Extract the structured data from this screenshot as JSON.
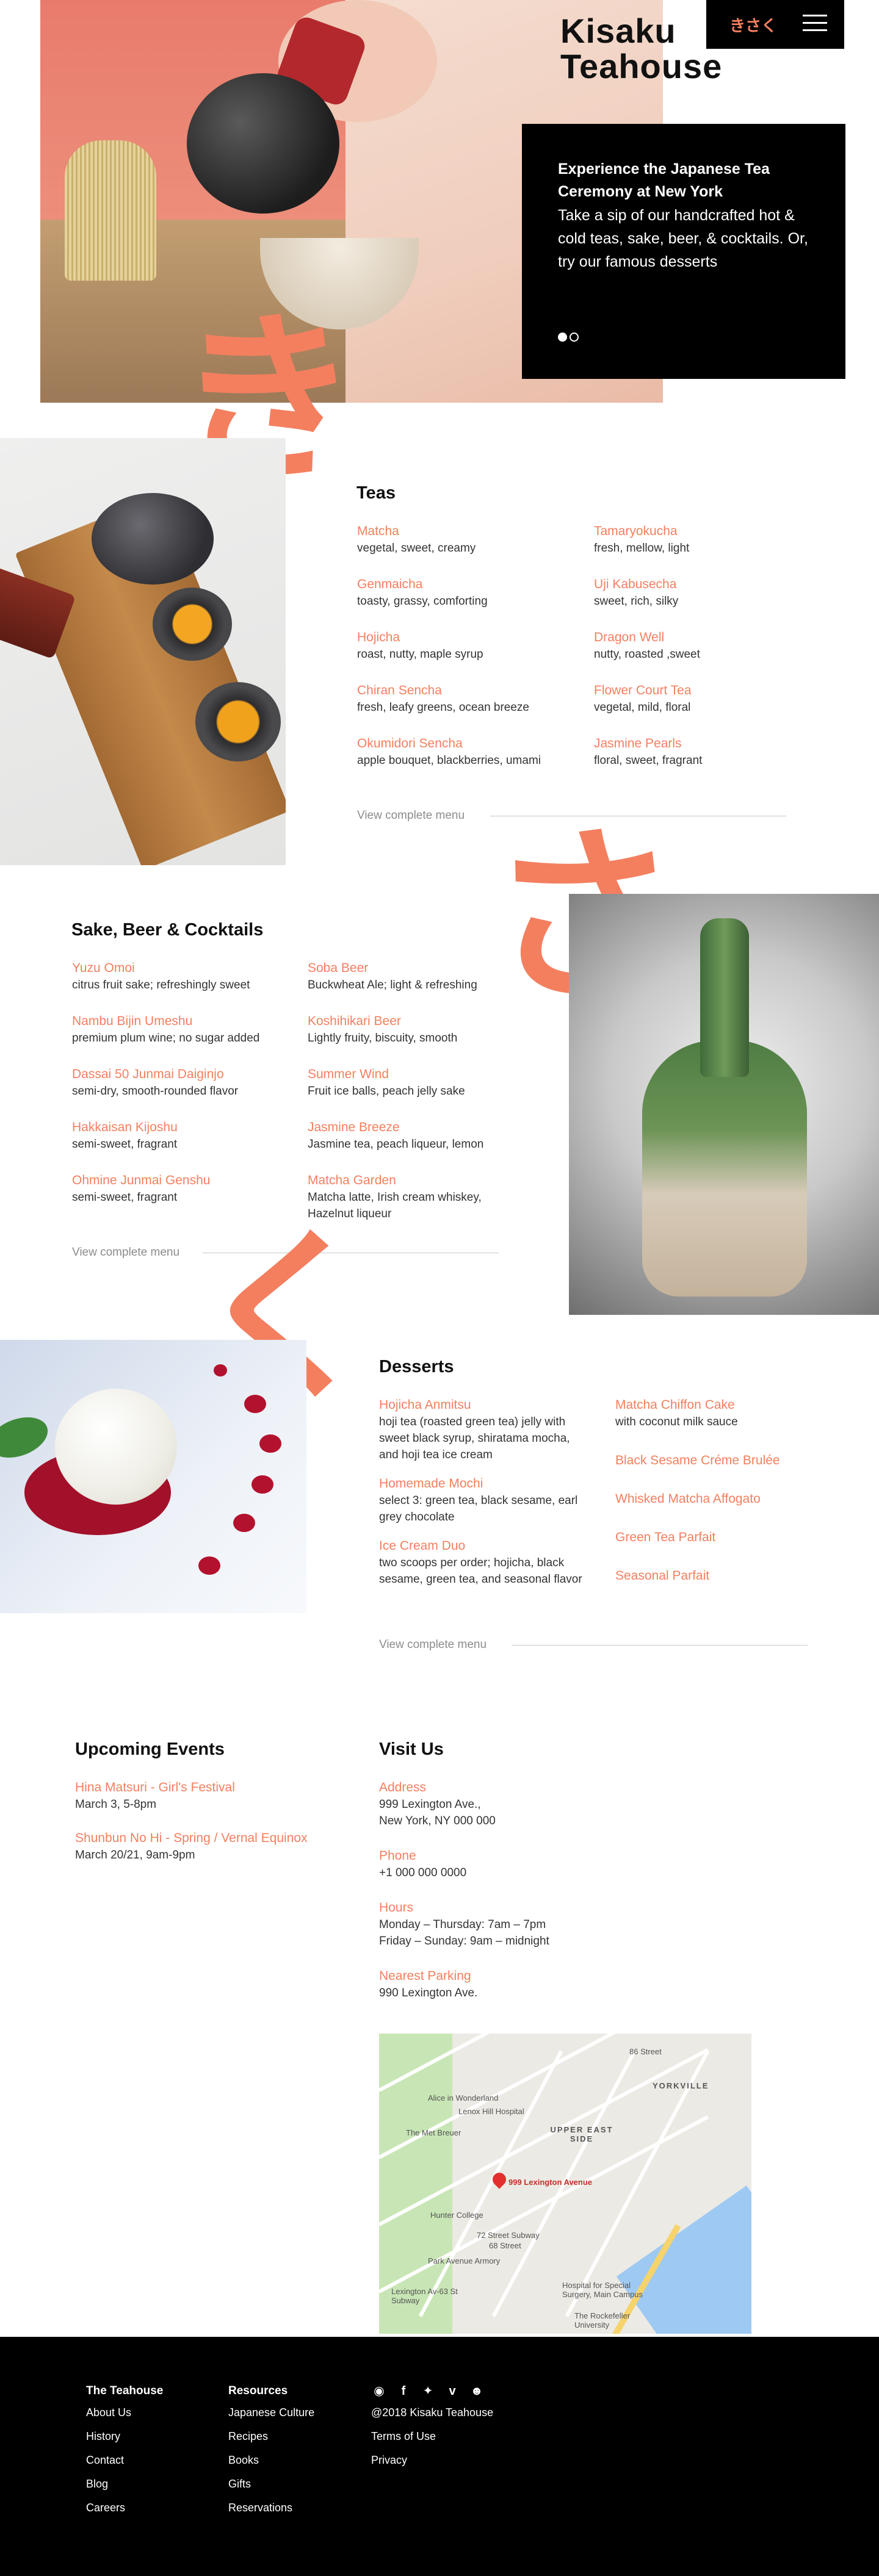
{
  "brand": {
    "name_line1": "Kisaku",
    "name_line2": "Teahouse",
    "logo_kana": "きさく"
  },
  "hero": {
    "heading": "Experience the Japanese Tea Ceremony at New York",
    "body": "Take a sip of our handcrafted hot & cold teas, sake, beer, & cocktails. Or, try our famous desserts"
  },
  "kana": {
    "ki": "き",
    "sa": "さ",
    "ku": "く"
  },
  "teas": {
    "title": "Teas",
    "items": [
      {
        "name": "Matcha",
        "desc": "vegetal, sweet, creamy"
      },
      {
        "name": "Tamaryokucha",
        "desc": "fresh, mellow, light"
      },
      {
        "name": "Genmaicha",
        "desc": "toasty, grassy, comforting"
      },
      {
        "name": "Uji Kabusecha",
        "desc": "sweet, rich, silky"
      },
      {
        "name": "Hojicha",
        "desc": "roast, nutty, maple syrup"
      },
      {
        "name": "Dragon Well",
        "desc": "nutty, roasted ,sweet"
      },
      {
        "name": "Chiran Sencha",
        "desc": "fresh, leafy greens, ocean breeze"
      },
      {
        "name": "Flower Court Tea",
        "desc": "vegetal, mild, floral"
      },
      {
        "name": "Okumidori Sencha",
        "desc": "apple bouquet, blackberries, umami"
      },
      {
        "name": "Jasmine Pearls",
        "desc": "floral, sweet, fragrant"
      }
    ],
    "link": "View complete menu"
  },
  "sake": {
    "title": "Sake, Beer & Cocktails",
    "items": [
      {
        "name": "Yuzu Omoi",
        "desc": "citrus fruit sake; refreshingly sweet"
      },
      {
        "name": "Soba Beer",
        "desc": "Buckwheat Ale; light & refreshing"
      },
      {
        "name": "Nambu Bijin Umeshu",
        "desc": "premium plum wine; no sugar added"
      },
      {
        "name": "Koshihikari Beer",
        "desc": "Lightly fruity, biscuity, smooth"
      },
      {
        "name": "Dassai 50 Junmai Daiginjo",
        "desc": "semi-dry, smooth-rounded flavor"
      },
      {
        "name": "Summer Wind",
        "desc": "Fruit ice balls, peach jelly sake"
      },
      {
        "name": "Hakkaisan Kijoshu",
        "desc": "semi-sweet, fragrant"
      },
      {
        "name": "Jasmine Breeze",
        "desc": "Jasmine tea, peach liqueur, lemon"
      },
      {
        "name": "Ohmine Junmai Genshu",
        "desc": "semi-sweet, fragrant"
      },
      {
        "name": "Matcha Garden",
        "desc": "Matcha latte, Irish cream whiskey, Hazelnut liqueur"
      }
    ],
    "link": "View complete menu"
  },
  "desserts": {
    "title": "Desserts",
    "left": [
      {
        "name": "Hojicha Anmitsu",
        "desc": "hoji tea (roasted green tea) jelly with sweet black syrup, shiratama mocha, and hoji tea ice cream"
      },
      {
        "name": "Homemade Mochi",
        "desc": "select 3: green tea, black sesame, earl grey chocolate"
      },
      {
        "name": "Ice Cream Duo",
        "desc": "two scoops per order;  hojicha, black sesame, green tea, and seasonal flavor"
      }
    ],
    "right": [
      {
        "name": "Matcha Chiffon Cake",
        "desc": "with coconut milk sauce"
      },
      {
        "name": "Black Sesame Créme Brulée",
        "desc": ""
      },
      {
        "name": "Whisked Matcha Affogato",
        "desc": ""
      },
      {
        "name": "Green Tea Parfait",
        "desc": ""
      },
      {
        "name": "Seasonal Parfait",
        "desc": ""
      }
    ],
    "link": "View complete menu"
  },
  "events": {
    "title": "Upcoming Events",
    "items": [
      {
        "name": "Hina Matsuri - Girl's Festival",
        "date": "March 3, 5-8pm"
      },
      {
        "name": "Shunbun No Hi - Spring / Vernal Equinox",
        "date": "March 20/21, 9am-9pm"
      }
    ]
  },
  "visit": {
    "title": "Visit Us",
    "address_label": "Address",
    "address_1": "999 Lexington Ave.,",
    "address_2": "New York, NY 000 000",
    "phone_label": "Phone",
    "phone": "+1 000 000 0000",
    "hours_label": "Hours",
    "hours_1": "Monday – Thursday: 7am – 7pm",
    "hours_2": "Friday – Sunday: 9am – midnight",
    "parking_label": "Nearest Parking",
    "parking": "990 Lexington Ave."
  },
  "map": {
    "pin_label": "999 Lexington Avenue",
    "labels": [
      "86 Street",
      "YORKVILLE",
      "Alice in Wonderland",
      "Lenox Hill Hospital",
      "The Met Breuer",
      "UPPER EAST SIDE",
      "Hunter College",
      "72 Street Subway",
      "68 Street",
      "Park Avenue Armory",
      "Hospital for Special Surgery, Main Campus",
      "Lexington Av-63 St Subway",
      "The Rockefeller University"
    ]
  },
  "footer": {
    "col1": {
      "head": "The Teahouse",
      "links": [
        "About Us",
        "History",
        "Contact",
        "Blog",
        "Careers"
      ]
    },
    "col2": {
      "head": "Resources",
      "links": [
        "Japanese Culture",
        "Recipes",
        "Books",
        "Gifts",
        "Reservations"
      ]
    },
    "social": [
      "instagram-icon",
      "facebook-icon",
      "twitter-icon",
      "vimeo-icon",
      "snapchat-icon"
    ],
    "copyright": "@2018 Kisaku Teahouse",
    "terms": "Terms of Use",
    "privacy": "Privacy"
  },
  "colors": {
    "accent": "#f47f5f",
    "dark": "#000000"
  }
}
